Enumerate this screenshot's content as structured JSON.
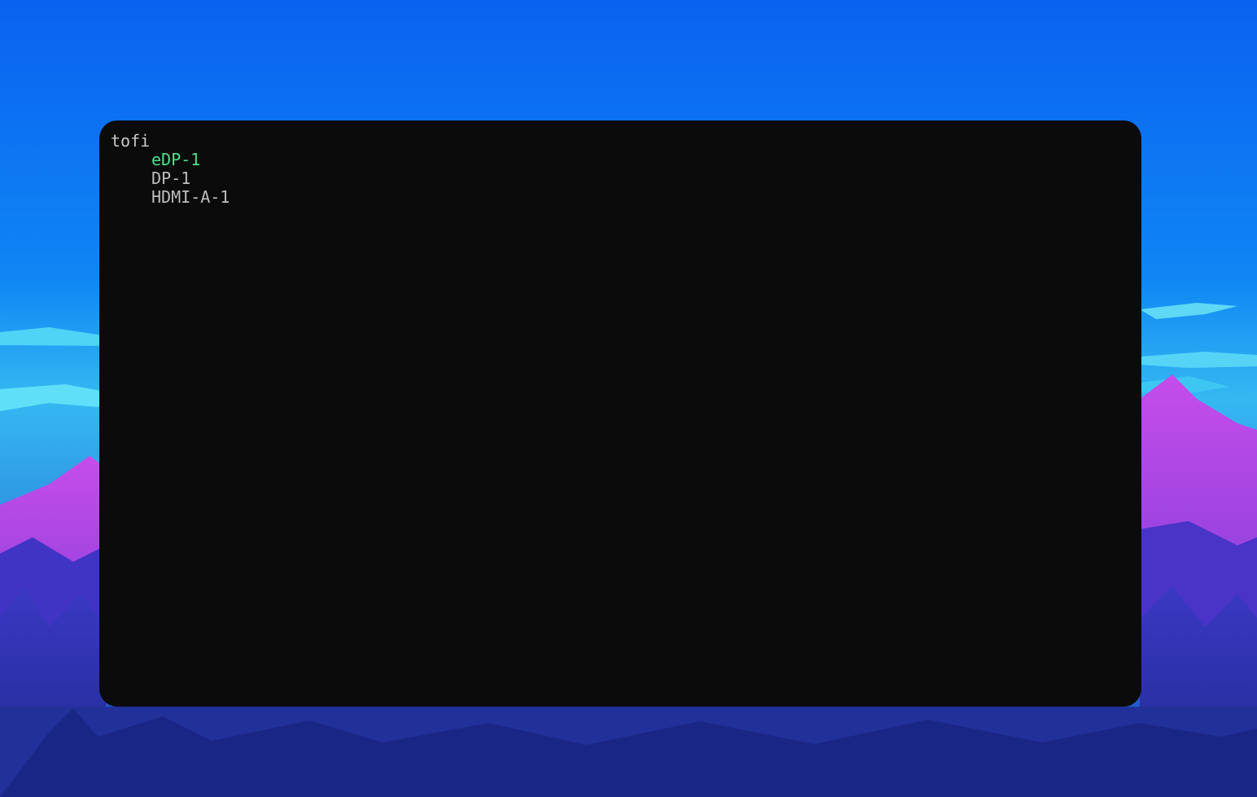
{
  "launcher": {
    "prompt": "tofi",
    "selected_color": "#4ee08a",
    "results": [
      {
        "label": "eDP-1",
        "selected": true
      },
      {
        "label": "DP-1",
        "selected": false
      },
      {
        "label": "HDMI-A-1",
        "selected": false
      }
    ]
  }
}
